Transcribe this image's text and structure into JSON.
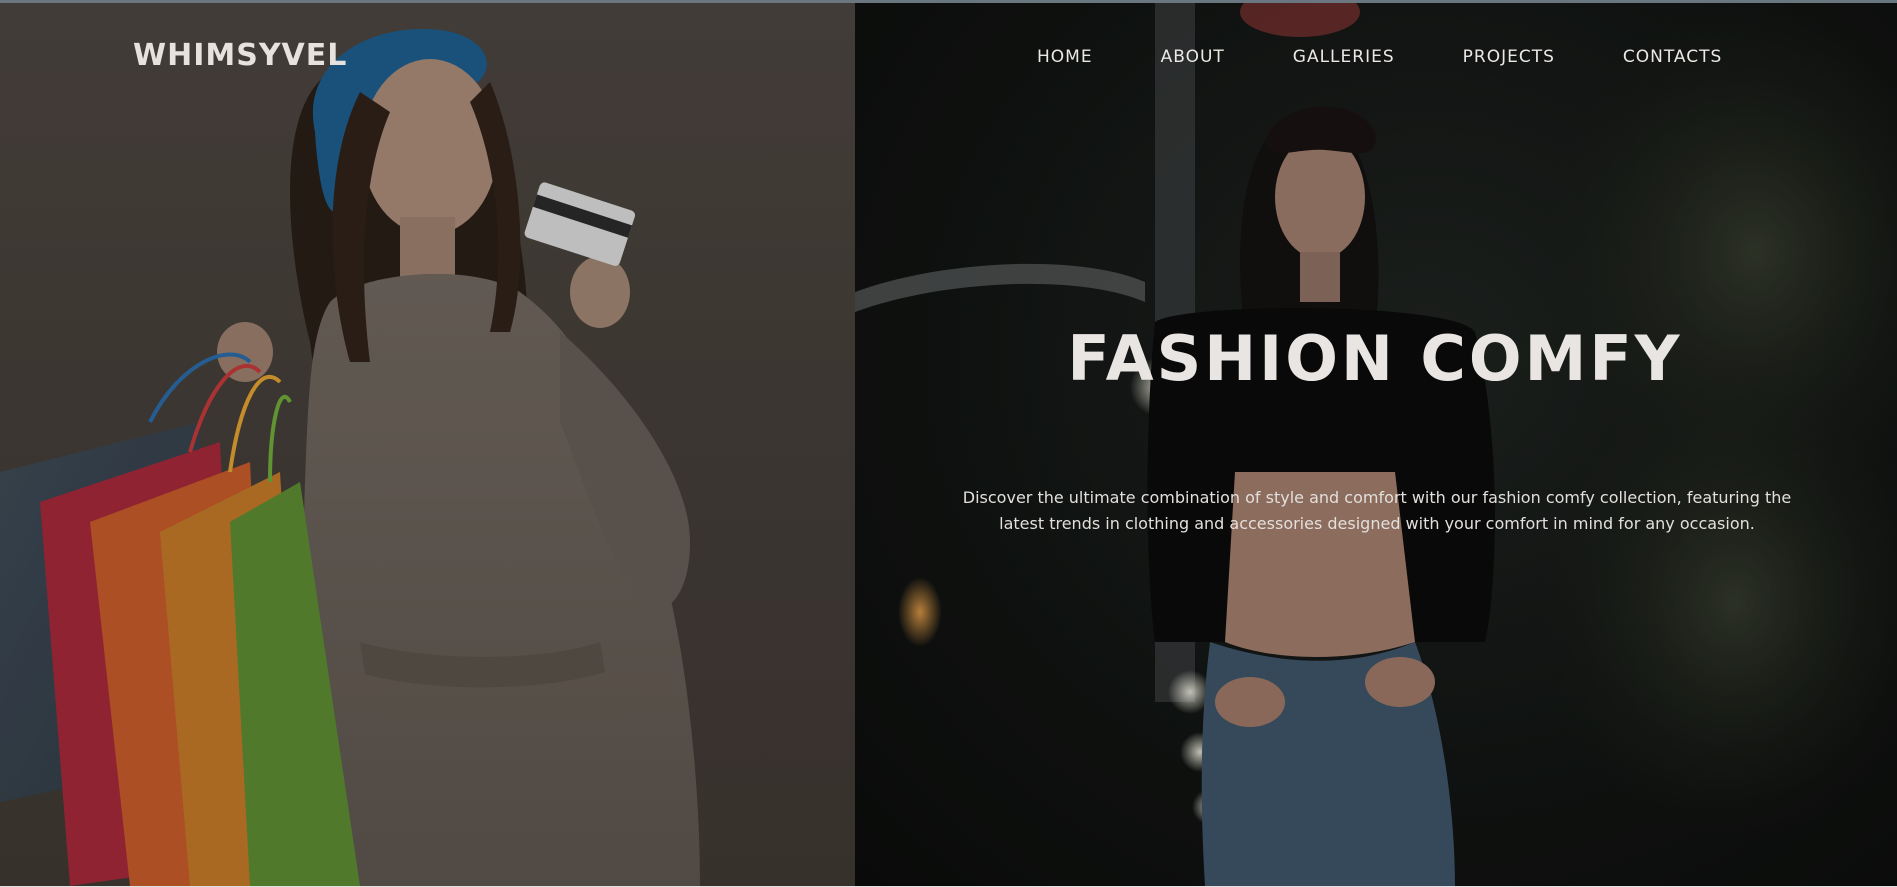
{
  "brand": {
    "name": "WHIMSYVEL"
  },
  "nav": {
    "items": [
      {
        "label": "HOME"
      },
      {
        "label": "ABOUT"
      },
      {
        "label": "GALLERIES"
      },
      {
        "label": "PROJECTS"
      },
      {
        "label": "CONTACTS"
      }
    ]
  },
  "hero": {
    "title": "FASHION COMFY",
    "description": "Discover the ultimate combination of style and comfort with our fashion comfy collection, featuring the latest trends in clothing and accessories designed with your comfort in mind for any occasion."
  },
  "colors": {
    "text": "#e8e5e3",
    "left_panel_bg": "#453e39",
    "right_panel_bg": "#121513"
  }
}
